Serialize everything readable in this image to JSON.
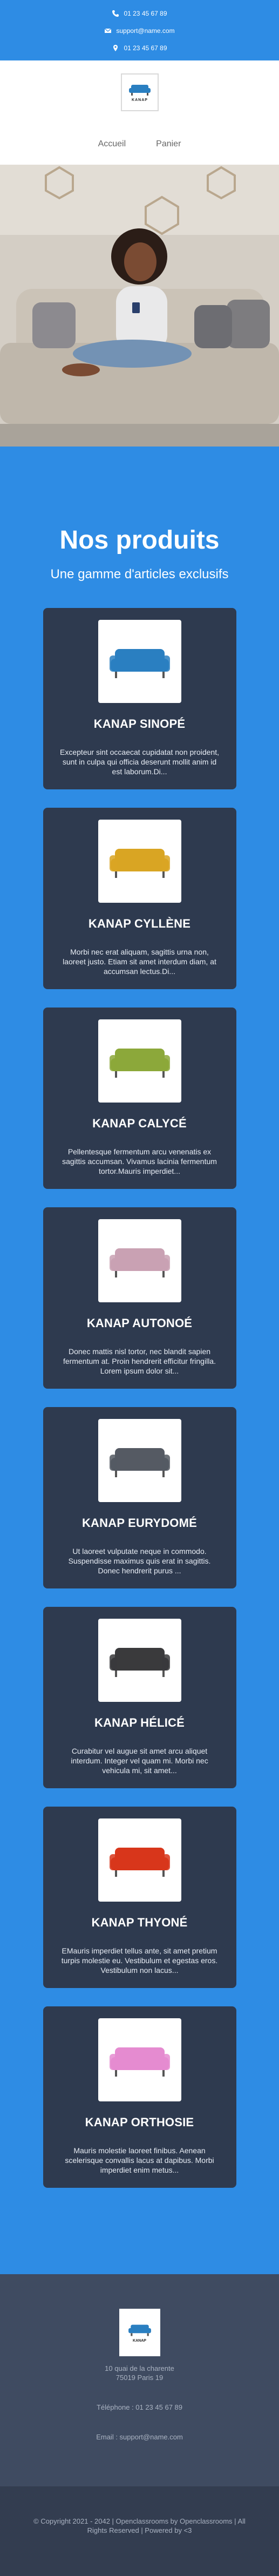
{
  "topbar": {
    "phone": "01 23 45 67 89",
    "email": "support@name.com",
    "address": "01 23 45 67 89"
  },
  "header": {
    "logo_text": "KANAP",
    "nav": [
      "Accueil",
      "Panier"
    ]
  },
  "products": {
    "title": "Nos produits",
    "subtitle": "Une gamme d'articles exclusifs",
    "items": [
      {
        "name": "KANAP SINOPÉ",
        "desc": "Excepteur sint occaecat cupidatat non proident, sunt in culpa qui officia deserunt mollit anim id est laborum.Di...",
        "color": "#2a7fc1"
      },
      {
        "name": "KANAP CYLLÈNE",
        "desc": "Morbi nec erat aliquam, sagittis urna non, laoreet justo. Etiam sit amet interdum diam, at accumsan lectus.Di...",
        "color": "#d9a523"
      },
      {
        "name": "KANAP CALYCÉ",
        "desc": "Pellentesque fermentum arcu venenatis ex sagittis accumsan. Vivamus lacinia fermentum tortor.Mauris imperdiet...",
        "color": "#8ca83a"
      },
      {
        "name": "KANAP AUTONOÉ",
        "desc": "Donec mattis nisl tortor, nec blandit sapien fermentum at. Proin hendrerit efficitur fringilla. Lorem ipsum dolor sit...",
        "color": "#c9a1b3"
      },
      {
        "name": "KANAP EURYDOMÉ",
        "desc": "Ut laoreet vulputate neque in commodo. Suspendisse maximus quis erat in sagittis. Donec hendrerit purus ...",
        "color": "#555a63"
      },
      {
        "name": "KANAP HÉLICÉ",
        "desc": "Curabitur vel augue sit amet arcu aliquet interdum. Integer vel quam mi. Morbi nec vehicula mi, sit amet...",
        "color": "#3a3a3c"
      },
      {
        "name": "KANAP THYONÉ",
        "desc": "EMauris imperdiet tellus ante, sit amet pretium turpis molestie eu. Vestibulum et egestas eros. Vestibulum non lacus...",
        "color": "#d8361b"
      },
      {
        "name": "KANAP ORTHOSIE",
        "desc": "Mauris molestie laoreet finibus. Aenean scelerisque convallis lacus at dapibus. Morbi imperdiet enim metus...",
        "color": "#e58bd0"
      }
    ]
  },
  "footer": {
    "logo_text": "KANAP",
    "address_1": "10 quai de la charente",
    "address_2": "75019 Paris 19",
    "phone": "Téléphone : 01 23 45 67 89",
    "email": "Email : support@name.com",
    "copyright_1": "© Copyright 2021 - 2042 | Openclassrooms by Openclassrooms | All",
    "copyright_2": "Rights Reserved | Powered by <3"
  }
}
